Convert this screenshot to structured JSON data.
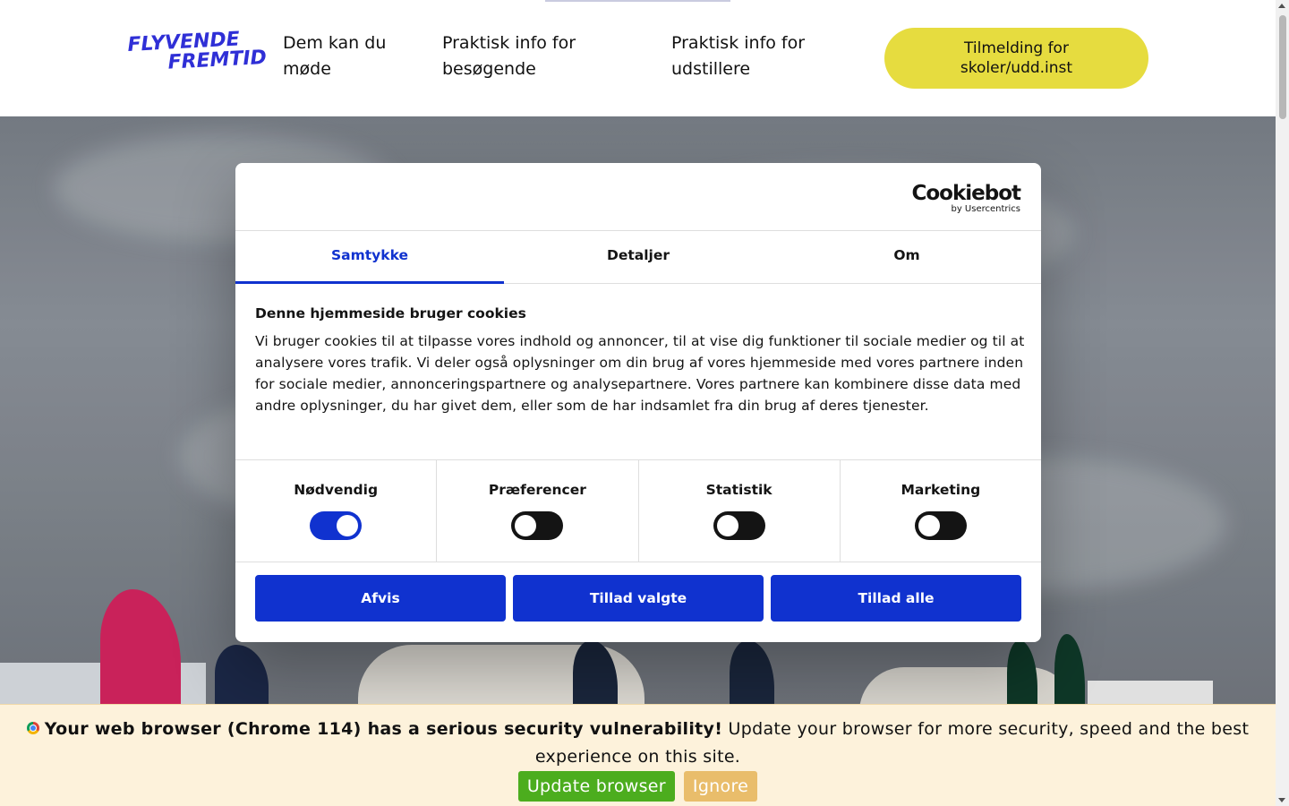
{
  "header": {
    "logo_line1": "FLYVENDE",
    "logo_line2": "FREMTID",
    "nav": [
      {
        "label": "Dem kan du møde"
      },
      {
        "label": "Praktisk info for besøgende"
      },
      {
        "label": "Praktisk info for udstillere"
      }
    ],
    "cta_label": "Tilmelding for skoler/udd.inst"
  },
  "cookie_dialog": {
    "brand": "Cookiebot",
    "brand_sub": "by Usercentrics",
    "tabs": [
      {
        "label": "Samtykke",
        "active": true
      },
      {
        "label": "Detaljer",
        "active": false
      },
      {
        "label": "Om",
        "active": false
      }
    ],
    "heading": "Denne hjemmeside bruger cookies",
    "body": "Vi bruger cookies til at tilpasse vores indhold og annoncer, til at vise dig funktioner til sociale medier og til at analysere vores trafik. Vi deler også oplysninger om din brug af vores hjemmeside med vores partnere inden for sociale medier, annonceringspartnere og analysepartnere. Vores partnere kan kombinere disse data med andre oplysninger, du har givet dem, eller som de har indsamlet fra din brug af deres tjenester.",
    "toggles": [
      {
        "label": "Nødvendig",
        "on": true
      },
      {
        "label": "Præferencer",
        "on": false
      },
      {
        "label": "Statistik",
        "on": false
      },
      {
        "label": "Marketing",
        "on": false
      }
    ],
    "buttons": {
      "reject": "Afvis",
      "allow_selected": "Tillad valgte",
      "allow_all": "Tillad alle"
    }
  },
  "browser_warning": {
    "bold": "Your web browser (Chrome 114) has a serious security vulnerability!",
    "text": " Update your browser for more security, speed and the best experience on this site.",
    "update_label": "Update browser",
    "ignore_label": "Ignore"
  },
  "colors": {
    "accent": "#1032cf",
    "cta": "#e6dc3f",
    "logo": "#2f2fd6",
    "update_button": "#4cad1e",
    "ignore_button": "#e9bd6b",
    "warning_bg": "#fdf2db"
  }
}
